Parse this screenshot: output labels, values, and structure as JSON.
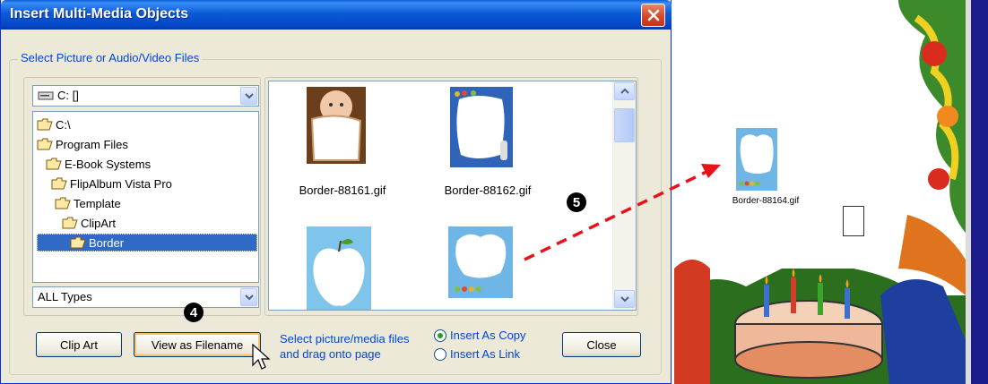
{
  "dialog": {
    "title": "Insert Multi-Media Objects",
    "group_label": "Select Picture or Audio/Video Files",
    "drive": "C: []",
    "types": "ALL Types",
    "tree": [
      {
        "label": "C:\\",
        "selected": false
      },
      {
        "label": "Program Files",
        "selected": false
      },
      {
        "label": "E-Book Systems",
        "selected": false
      },
      {
        "label": "FlipAlbum Vista Pro",
        "selected": false
      },
      {
        "label": "Template",
        "selected": false
      },
      {
        "label": "ClipArt",
        "selected": false
      },
      {
        "label": "Border",
        "selected": true
      }
    ],
    "thumbnails": [
      {
        "caption": "Border-88161.gif",
        "icon": "baby-photo-frame"
      },
      {
        "caption": "Border-88162.gif",
        "icon": "blue-bottle-frame"
      },
      {
        "caption": "",
        "icon": "apple-frame"
      },
      {
        "caption": "",
        "icon": "cloud-frame"
      }
    ],
    "buttons": {
      "clip_art": "Clip Art",
      "view_as": "View as Filename",
      "close": "Close"
    },
    "hint": {
      "line1": "Select picture/media files",
      "line2": "and drag onto page"
    },
    "radios": {
      "copy": "Insert As Copy",
      "link": "Insert As Link",
      "selected": "copy"
    }
  },
  "steps": {
    "four": "4",
    "five": "5"
  },
  "page": {
    "dropped_caption": "Border-88164.gif"
  },
  "colors": {
    "titlebar": "#0054e3",
    "accent_text": "#0046d5",
    "selection": "#316ac5",
    "arrow": "#e8121b"
  }
}
